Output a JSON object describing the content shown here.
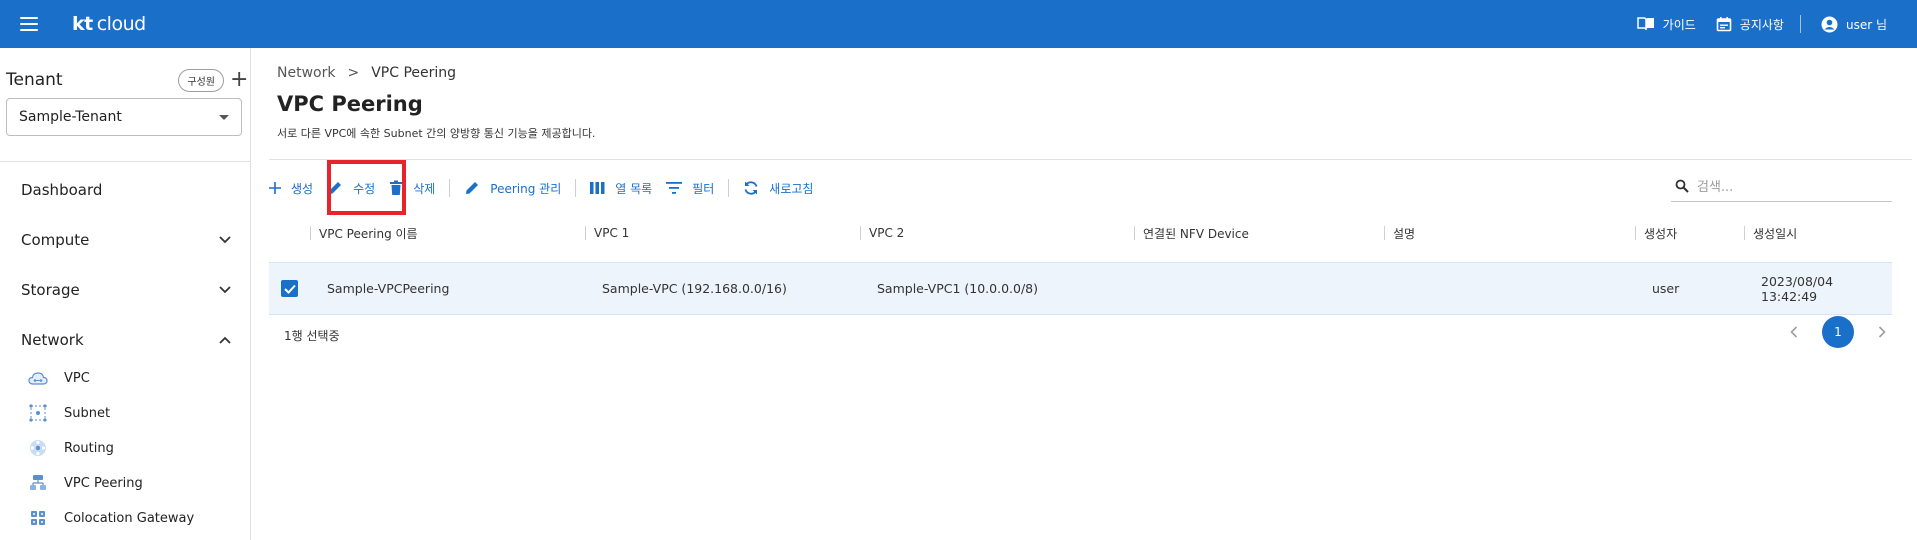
{
  "header": {
    "logo_kt": "kt",
    "logo_cloud": "cloud",
    "guide": "가이드",
    "notice": "공지사항",
    "user": "user 님"
  },
  "sidebar": {
    "tenant_title": "Tenant",
    "member_button": "구성원",
    "tenant_selected": "Sample-Tenant",
    "nav": [
      {
        "label": "Dashboard"
      },
      {
        "label": "Compute"
      },
      {
        "label": "Storage"
      },
      {
        "label": "Network"
      }
    ],
    "network_items": [
      {
        "label": "VPC",
        "icon": "vpc-cloud-icon"
      },
      {
        "label": "Subnet",
        "icon": "subnet-icon"
      },
      {
        "label": "Routing",
        "icon": "routing-icon"
      },
      {
        "label": "VPC Peering",
        "icon": "vpc-peering-icon"
      },
      {
        "label": "Colocation Gateway",
        "icon": "colocation-gateway-icon"
      }
    ]
  },
  "main": {
    "breadcrumb": {
      "parent": "Network",
      "separator": ">",
      "current": "VPC Peering"
    },
    "title": "VPC Peering",
    "description": "서로 다른 VPC에 속한 Subnet 간의 양방향 통신 기능을 제공합니다.",
    "toolbar": {
      "create": "생성",
      "edit": "수정",
      "delete": "삭제",
      "peering_manage": "Peering 관리",
      "columns": "열 목록",
      "filter": "필터",
      "refresh": "새로고침"
    },
    "search_placeholder": "검색...",
    "table": {
      "columns": [
        "VPC Peering 이름",
        "VPC 1",
        "VPC 2",
        "연결된 NFV Device",
        "설명",
        "생성자",
        "생성일시"
      ],
      "rows": [
        {
          "checked": true,
          "name": "Sample-VPCPeering",
          "vpc1": "Sample-VPC (192.168.0.0/16)",
          "vpc2": "Sample-VPC1 (10.0.0.0/8)",
          "nfv": "",
          "desc": "",
          "creator": "user",
          "created": "2023/08/04 13:42:49"
        }
      ]
    },
    "selection_status": "1행 선택중",
    "pagination": {
      "current_page": "1"
    }
  },
  "colors": {
    "primary": "#1a6fc9",
    "highlight": "#e8242b",
    "row_selected": "#eef4fb"
  }
}
